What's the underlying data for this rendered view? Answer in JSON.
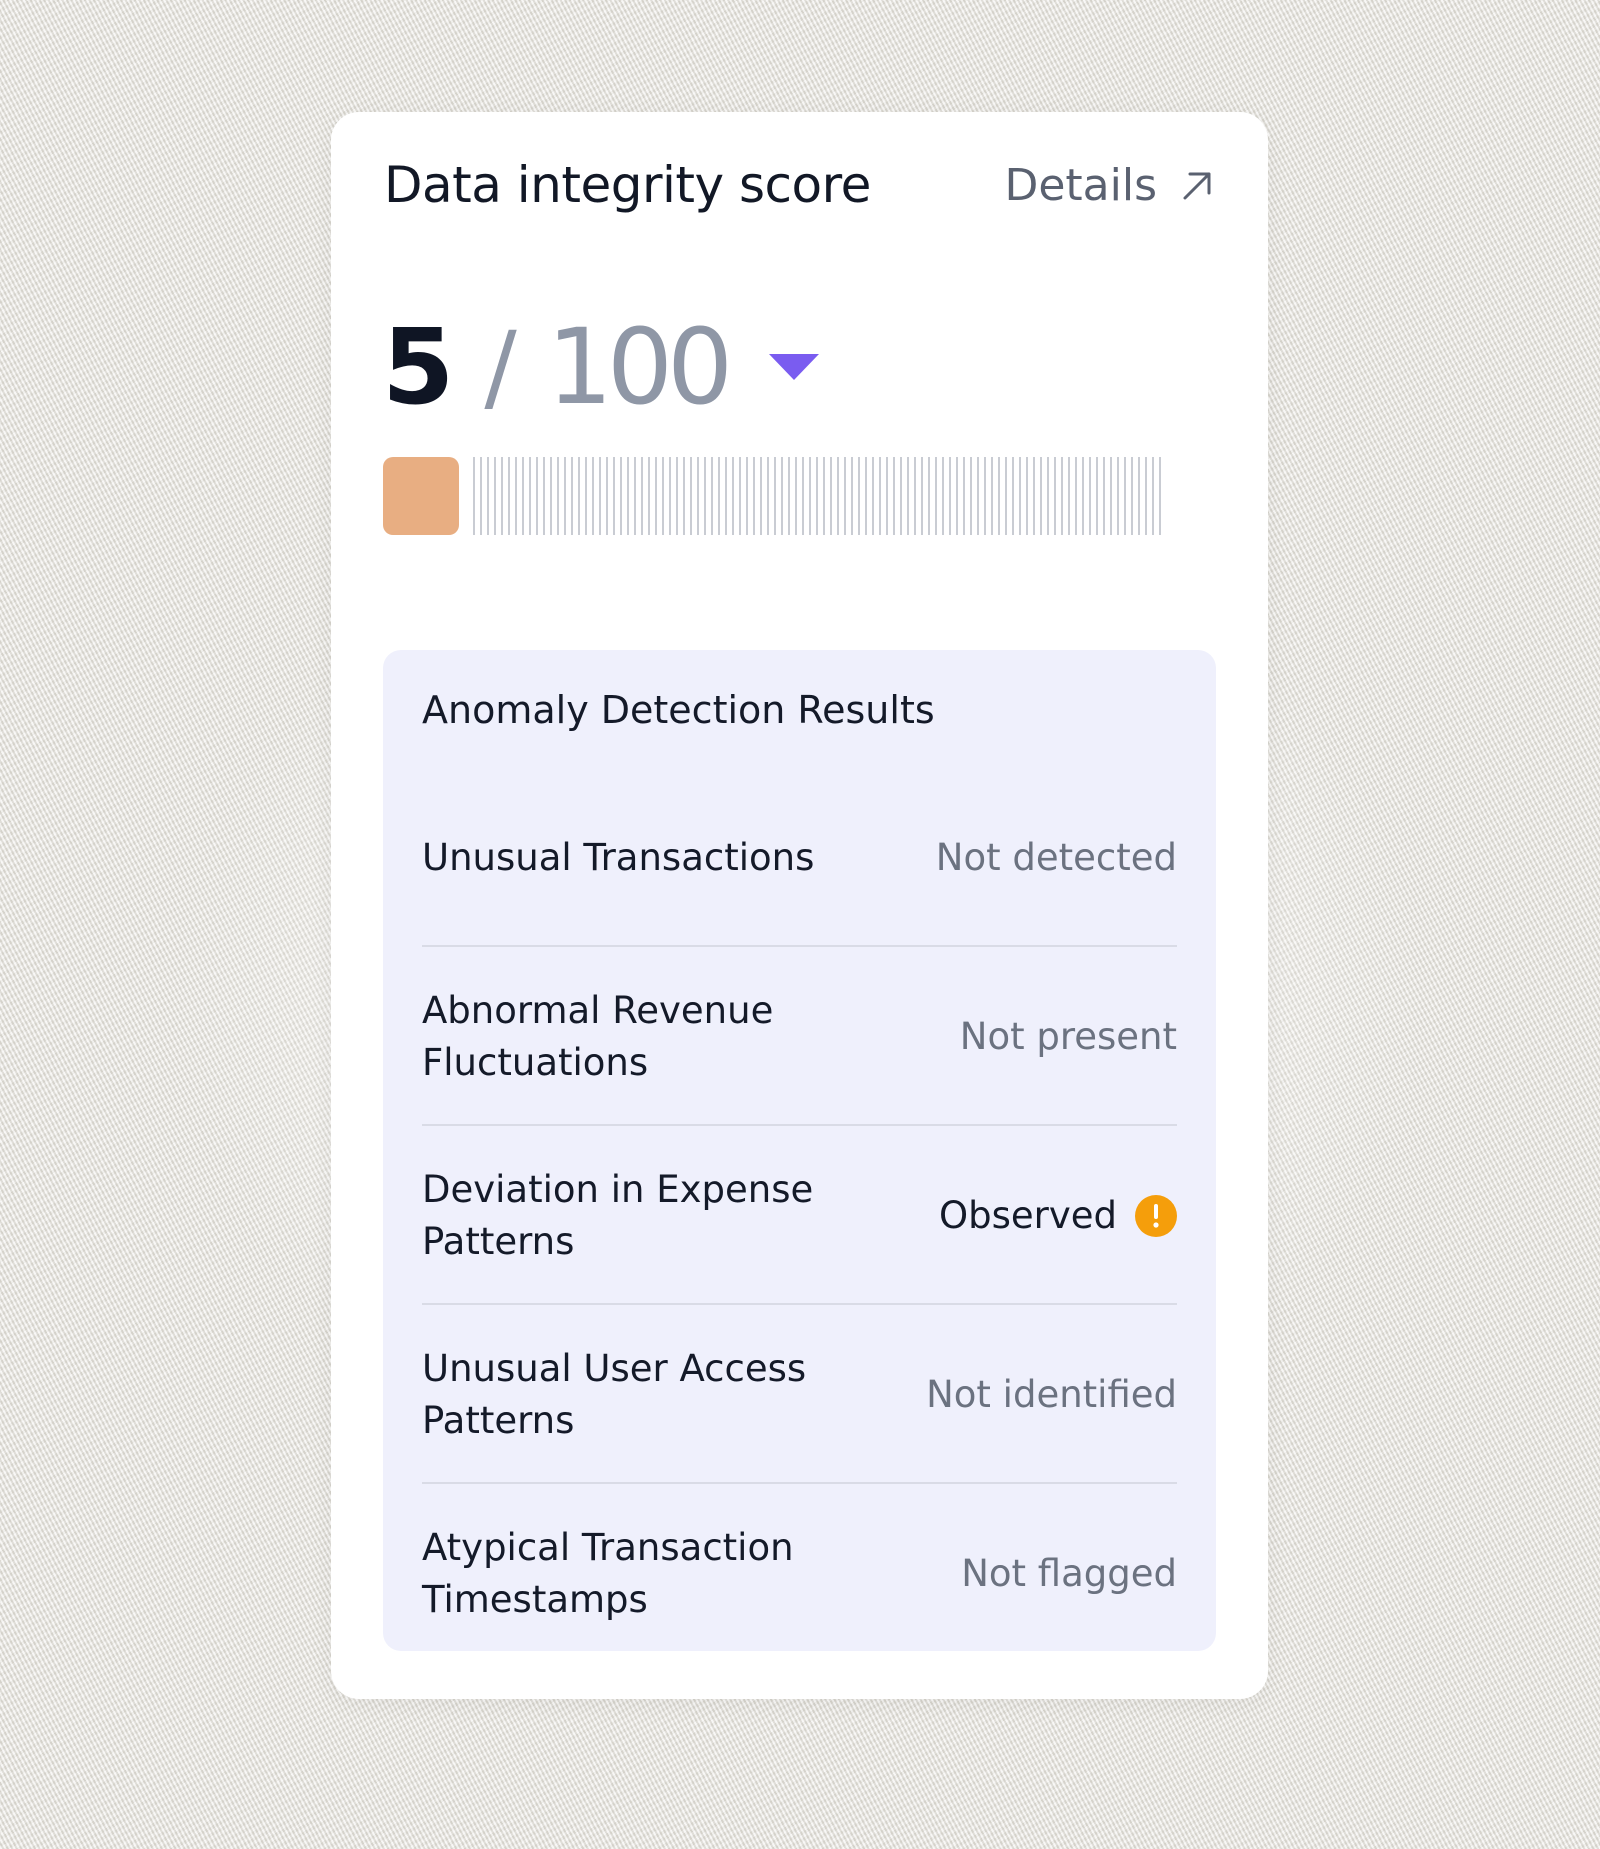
{
  "card": {
    "title": "Data integrity score",
    "details_label": "Details",
    "details_icon": "arrow-up-right-icon"
  },
  "score": {
    "value": "5",
    "separator": "/",
    "max": "100",
    "trend_icon": "caret-down-icon",
    "trend_color": "#7a5cf0",
    "progress_fraction": 0.05
  },
  "colors": {
    "progress_fill": "#e8ae82",
    "panel_background": "#eff0fc",
    "warning": "#f59e0b"
  },
  "anomaly_panel": {
    "title": "Anomaly Detection Results",
    "rows": [
      {
        "label": "Unusual Transactions",
        "status": "Not detected",
        "alert": false
      },
      {
        "label": "Abnormal Revenue Fluctuations",
        "status": "Not present",
        "alert": false
      },
      {
        "label": "Deviation in Expense Patterns",
        "status": "Observed",
        "alert": true,
        "icon": "warning-icon"
      },
      {
        "label": "Unusual User Access Patterns",
        "status": "Not identified",
        "alert": false
      },
      {
        "label": "Atypical Transaction Timestamps",
        "status": "Not flagged",
        "alert": false
      }
    ]
  }
}
